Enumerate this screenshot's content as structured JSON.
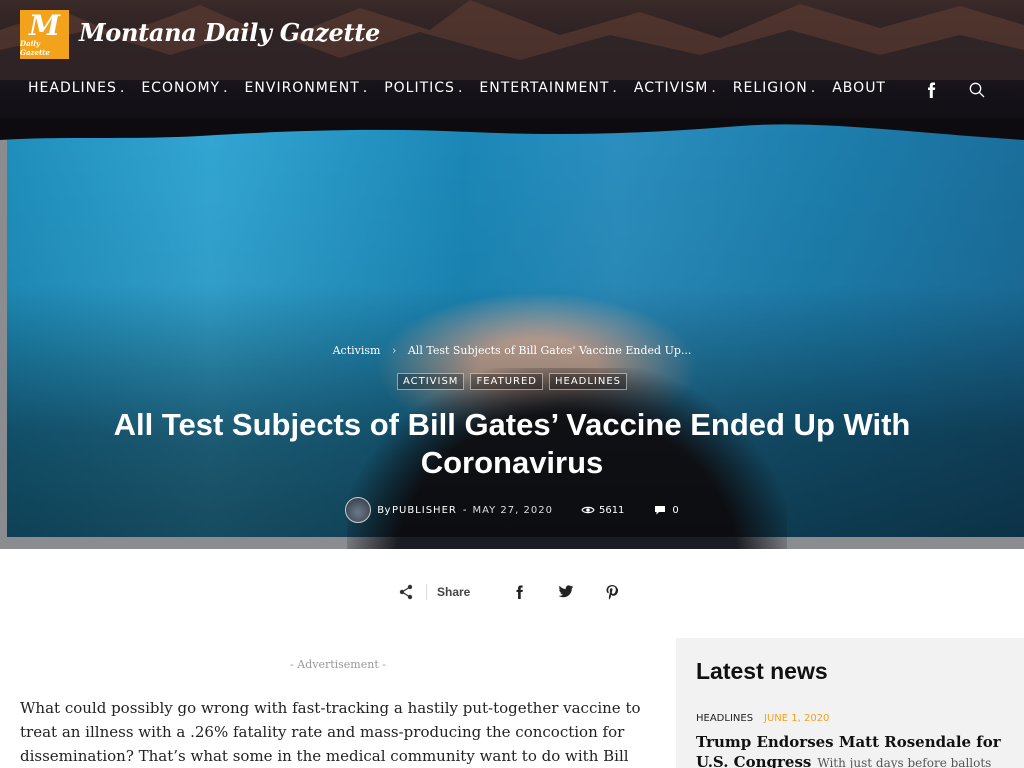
{
  "site": {
    "logo_letter": "M",
    "logo_sub": "Daily Gazette",
    "title": "Montana Daily Gazette",
    "brand_color": "#f2a31b"
  },
  "nav": {
    "items": [
      {
        "label": "HEADLINES",
        "sep": "."
      },
      {
        "label": "ECONOMY",
        "sep": "."
      },
      {
        "label": "ENVIRONMENT",
        "sep": "."
      },
      {
        "label": "POLITICS",
        "sep": "."
      },
      {
        "label": "ENTERTAINMENT",
        "sep": "."
      },
      {
        "label": "ACTIVISM",
        "sep": "."
      },
      {
        "label": "RELIGION",
        "sep": "."
      },
      {
        "label": "ABOUT",
        "sep": ""
      }
    ],
    "icons": [
      "facebook-icon",
      "search-icon"
    ]
  },
  "hero": {
    "breadcrumb": {
      "parent": "Activism",
      "current": "All Test Subjects of Bill Gates' Vaccine Ended Up..."
    },
    "categories": [
      "ACTIVISM",
      "FEATURED",
      "HEADLINES"
    ],
    "title": "All Test Subjects of Bill Gates’ Vaccine Ended Up With Coronavirus",
    "meta": {
      "by": "By",
      "author": "PUBLISHER",
      "dash": "-",
      "date": "MAY 27, 2020",
      "views": "5611",
      "comments": "0"
    }
  },
  "share": {
    "label": "Share",
    "buttons": [
      "facebook-icon",
      "twitter-icon",
      "pinterest-icon"
    ]
  },
  "article": {
    "ad_label": "- Advertisement -",
    "paragraph": "What could possibly go wrong with fast-tracking a hastily put-together vaccine to treat an illness with a .26% fatality rate and mass-producing the concoction for dissemination? That’s what some in the medical community want to do with Bill Gates’ new vaccine for"
  },
  "sidebar": {
    "title": "Latest news",
    "item": {
      "category": "HEADLINES",
      "date": "JUNE 1, 2020",
      "headline": "Trump Endorses Matt Rosendale for U.S. Congress",
      "excerpt": "With just days before ballots will"
    }
  }
}
